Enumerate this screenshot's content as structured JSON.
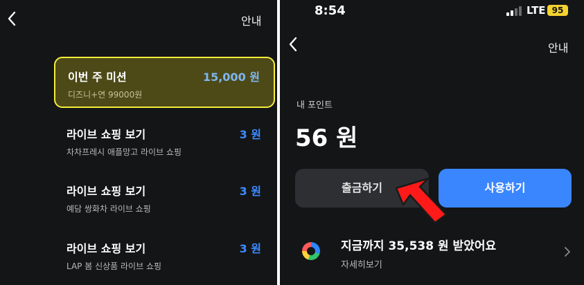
{
  "left": {
    "guide_label": "안내",
    "missions": [
      {
        "title": "이번 주 미션",
        "desc": "디즈니+연 99000원",
        "reward": "15,000 원"
      },
      {
        "title": "라이브 쇼핑 보기",
        "desc": "차차프레시 애플망고 라이브 쇼핑",
        "reward": "3 원"
      },
      {
        "title": "라이브 쇼핑 보기",
        "desc": "예담 쌍화차 라이브 쇼핑",
        "reward": "3 원"
      },
      {
        "title": "라이브 쇼핑 보기",
        "desc": "LAP 봄 신상품 라이브 쇼핑",
        "reward": "3 원"
      }
    ]
  },
  "right": {
    "status": {
      "time": "8:54",
      "network": "LTE",
      "battery": "95"
    },
    "guide_label": "안내",
    "point_label": "내 포인트",
    "point_value": "56 원",
    "withdraw_label": "출금하기",
    "use_label": "사용하기",
    "summary_text": "지금까지 35,538 원 받았어요",
    "summary_sub": "자세히보기"
  },
  "colors": {
    "background": "#141517",
    "accent_blue": "#3a86ff",
    "highlight_border": "#f6ee3c",
    "highlight_fill": "#4d4a18",
    "pointer_red": "#ff1a1a"
  },
  "icons": [
    "back-icon",
    "signal-icon",
    "battery-icon",
    "donut-chart-icon",
    "chevron-right-icon",
    "red-arrow-pointer"
  ]
}
